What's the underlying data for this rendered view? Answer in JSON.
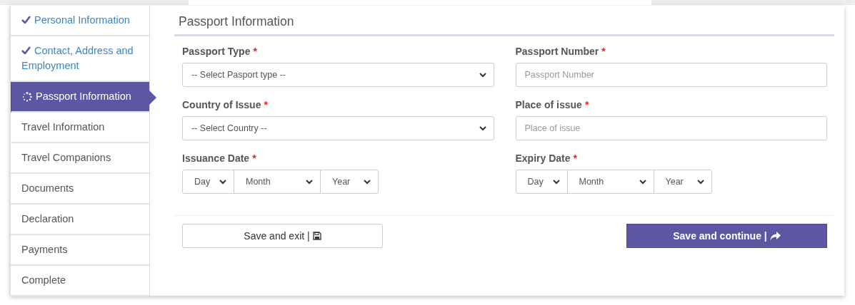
{
  "steps": [
    {
      "label": "Personal Information",
      "kind": "done",
      "selected": false
    },
    {
      "label": "Contact, Address and Employment",
      "kind": "done",
      "selected": false
    },
    {
      "label": "Passport Information",
      "kind": "current",
      "selected": true
    },
    {
      "label": "Travel Information",
      "kind": "pending",
      "selected": false
    },
    {
      "label": "Travel Companions",
      "kind": "pending",
      "selected": false
    },
    {
      "label": "Documents",
      "kind": "pending",
      "selected": false
    },
    {
      "label": "Declaration",
      "kind": "pending",
      "selected": false
    },
    {
      "label": "Payments",
      "kind": "pending",
      "selected": false
    },
    {
      "label": "Complete",
      "kind": "pending",
      "selected": false
    }
  ],
  "section_title": "Passport Information",
  "fields": [
    {
      "kind": "select",
      "label": "Passport Type",
      "required_mark": "*",
      "value": "-- Select Pasport type --"
    },
    {
      "kind": "input",
      "label": "Passport Number",
      "required_mark": "*",
      "placeholder": "Passport Number"
    },
    {
      "kind": "select",
      "label": "Country of Issue",
      "required_mark": "*",
      "value": "-- Select Country --"
    },
    {
      "kind": "input",
      "label": "Place of issue",
      "required_mark": "*",
      "placeholder": "Place of issue"
    },
    {
      "kind": "date",
      "label": "Issuance Date",
      "required_mark": "*",
      "parts": [
        "Day",
        "Month",
        "Year"
      ]
    },
    {
      "kind": "date",
      "label": "Expiry Date",
      "required_mark": "*",
      "parts": [
        "Day",
        "Month",
        "Year"
      ]
    }
  ],
  "buttons": [
    {
      "kind": "secondary",
      "label": "Save and exit |"
    },
    {
      "kind": "primary",
      "label": "Save and continue |"
    }
  ]
}
